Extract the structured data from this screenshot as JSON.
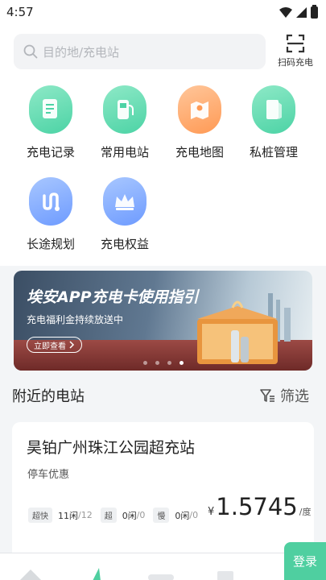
{
  "status_bar": {
    "time": "4:57"
  },
  "search": {
    "placeholder": "目的地/充电站"
  },
  "scan": {
    "label": "扫码充电"
  },
  "quick_actions": [
    {
      "label": "充电记录",
      "icon": "record-icon",
      "color": "#4cd3a5"
    },
    {
      "label": "常用电站",
      "icon": "station-icon",
      "color": "#4cd3a5"
    },
    {
      "label": "充电地图",
      "icon": "map-icon",
      "color": "#ff9a55"
    },
    {
      "label": "私桩管理",
      "icon": "private-pile-icon",
      "color": "#4cd3a5"
    },
    {
      "label": "长途规划",
      "icon": "route-icon",
      "color": "#6e9bff"
    },
    {
      "label": "充电权益",
      "icon": "crown-icon",
      "color": "#6e9bff"
    }
  ],
  "banner": {
    "title": "埃安APP充电卡使用指引",
    "subtitle": "充电福利金持续放送中",
    "button": "立即查看",
    "slide_count": 4,
    "active_slide": 4
  },
  "nearby": {
    "title": "附近的电站",
    "filter_label": "筛选"
  },
  "station": {
    "name": "昊铂广州珠江公园超充站",
    "tag": "停车优惠",
    "chargers": [
      {
        "type": "超快",
        "idle": "11闲",
        "total": "/12"
      },
      {
        "type": "超",
        "idle": "0闲",
        "total": "/0"
      },
      {
        "type": "慢",
        "idle": "0闲",
        "total": "/0"
      }
    ],
    "price_currency": "¥",
    "price": "1.5745",
    "price_unit": "/度"
  },
  "login": {
    "label": "登录"
  },
  "colors": {
    "accent": "#4fcfa0",
    "background": "#f3f5f7"
  }
}
